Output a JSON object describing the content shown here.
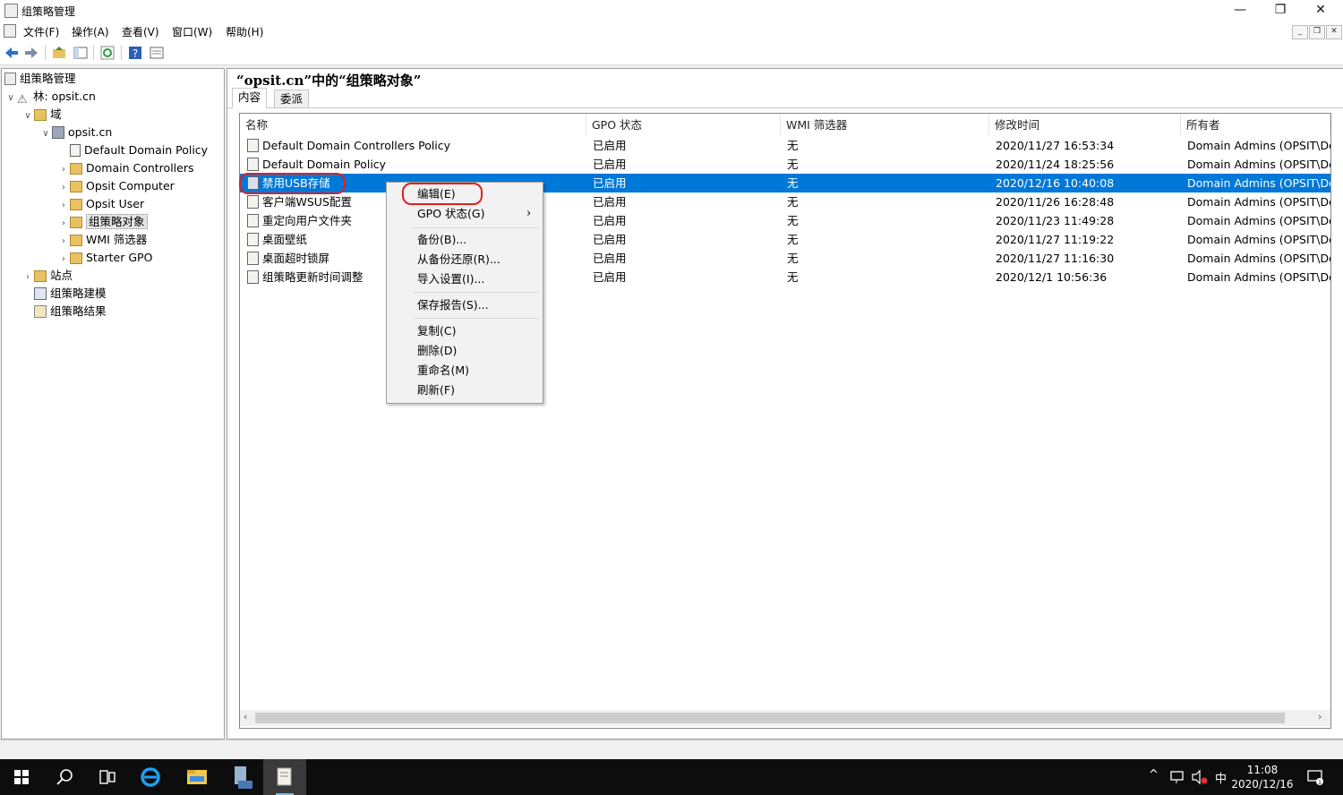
{
  "window": {
    "title": "组策略管理",
    "controls": {
      "minimize": "—",
      "restore": "❐",
      "close": "✕"
    }
  },
  "menu": [
    "文件(F)",
    "操作(A)",
    "查看(V)",
    "窗口(W)",
    "帮助(H)"
  ],
  "toolbar_icons": [
    "back-arrow-icon",
    "forward-arrow-icon",
    "up-folder-icon",
    "show-hide-tree-icon",
    "refresh-icon",
    "help-icon",
    "properties-icon"
  ],
  "tree": {
    "root": "组策略管理",
    "forest": "林: opsit.cn",
    "domains": "域",
    "domain": "opsit.cn",
    "children": [
      "Default Domain Policy",
      "Domain Controllers",
      "Opsit Computer",
      "Opsit User",
      "组策略对象",
      "WMI 筛选器",
      "Starter GPO"
    ],
    "sites": "站点",
    "modeling": "组策略建模",
    "results": "组策略结果"
  },
  "right_pane": {
    "title": "“opsit.cn”中的“组策略对象”",
    "tabs": [
      "内容",
      "委派"
    ],
    "columns": [
      "名称",
      "GPO 状态",
      "WMI 筛选器",
      "修改时间",
      "所有者"
    ],
    "rows": [
      {
        "name": "Default Domain Controllers Policy",
        "status": "已启用",
        "wmi": "无",
        "modified": "2020/11/27 16:53:34",
        "owner": "Domain Admins (OPSIT\\Domain Admins)"
      },
      {
        "name": "Default Domain Policy",
        "status": "已启用",
        "wmi": "无",
        "modified": "2020/11/24 18:25:56",
        "owner": "Domain Admins (OPSIT\\Domain Admins)"
      },
      {
        "name": "禁用USB存储",
        "status": "已启用",
        "wmi": "无",
        "modified": "2020/12/16 10:40:08",
        "owner": "Domain Admins (OPSIT\\Domain Admins)"
      },
      {
        "name": "客户端WSUS配置",
        "status": "已启用",
        "wmi": "无",
        "modified": "2020/11/26 16:28:48",
        "owner": "Domain Admins (OPSIT\\Domain Admins)"
      },
      {
        "name": "重定向用户文件夹",
        "status": "已启用",
        "wmi": "无",
        "modified": "2020/11/23 11:49:28",
        "owner": "Domain Admins (OPSIT\\Domain Admins)"
      },
      {
        "name": "桌面壁纸",
        "status": "已启用",
        "wmi": "无",
        "modified": "2020/11/27 11:19:22",
        "owner": "Domain Admins (OPSIT\\Domain Admins)"
      },
      {
        "name": "桌面超时锁屏",
        "status": "已启用",
        "wmi": "无",
        "modified": "2020/11/27 11:16:30",
        "owner": "Domain Admins (OPSIT\\Domain Admins)"
      },
      {
        "name": "组策略更新时间调整",
        "status": "已启用",
        "wmi": "无",
        "modified": "2020/12/1 10:56:36",
        "owner": "Domain Admins (OPSIT\\Domain Admins)"
      }
    ],
    "selected_row_index": 2
  },
  "context_menu": {
    "items": [
      "编辑(E)",
      "GPO 状态(G)",
      "备份(B)...",
      "从备份还原(R)...",
      "导入设置(I)...",
      "保存报告(S)...",
      "复制(C)",
      "删除(D)",
      "重命名(M)",
      "刷新(F)"
    ],
    "submenu_arrow": "›"
  },
  "taskbar": {
    "icons": [
      "windows-start-icon",
      "search-icon",
      "task-view-icon",
      "internet-explorer-icon",
      "file-explorer-icon",
      "server-manager-icon",
      "group-policy-icon"
    ],
    "tray": {
      "chevron": "^",
      "ime": "中"
    },
    "time": "11:08",
    "date": "2020/12/16"
  },
  "colors": {
    "selection": "#0078d7",
    "highlight_mark": "#e02020",
    "taskbar": "#0d0d0d"
  }
}
